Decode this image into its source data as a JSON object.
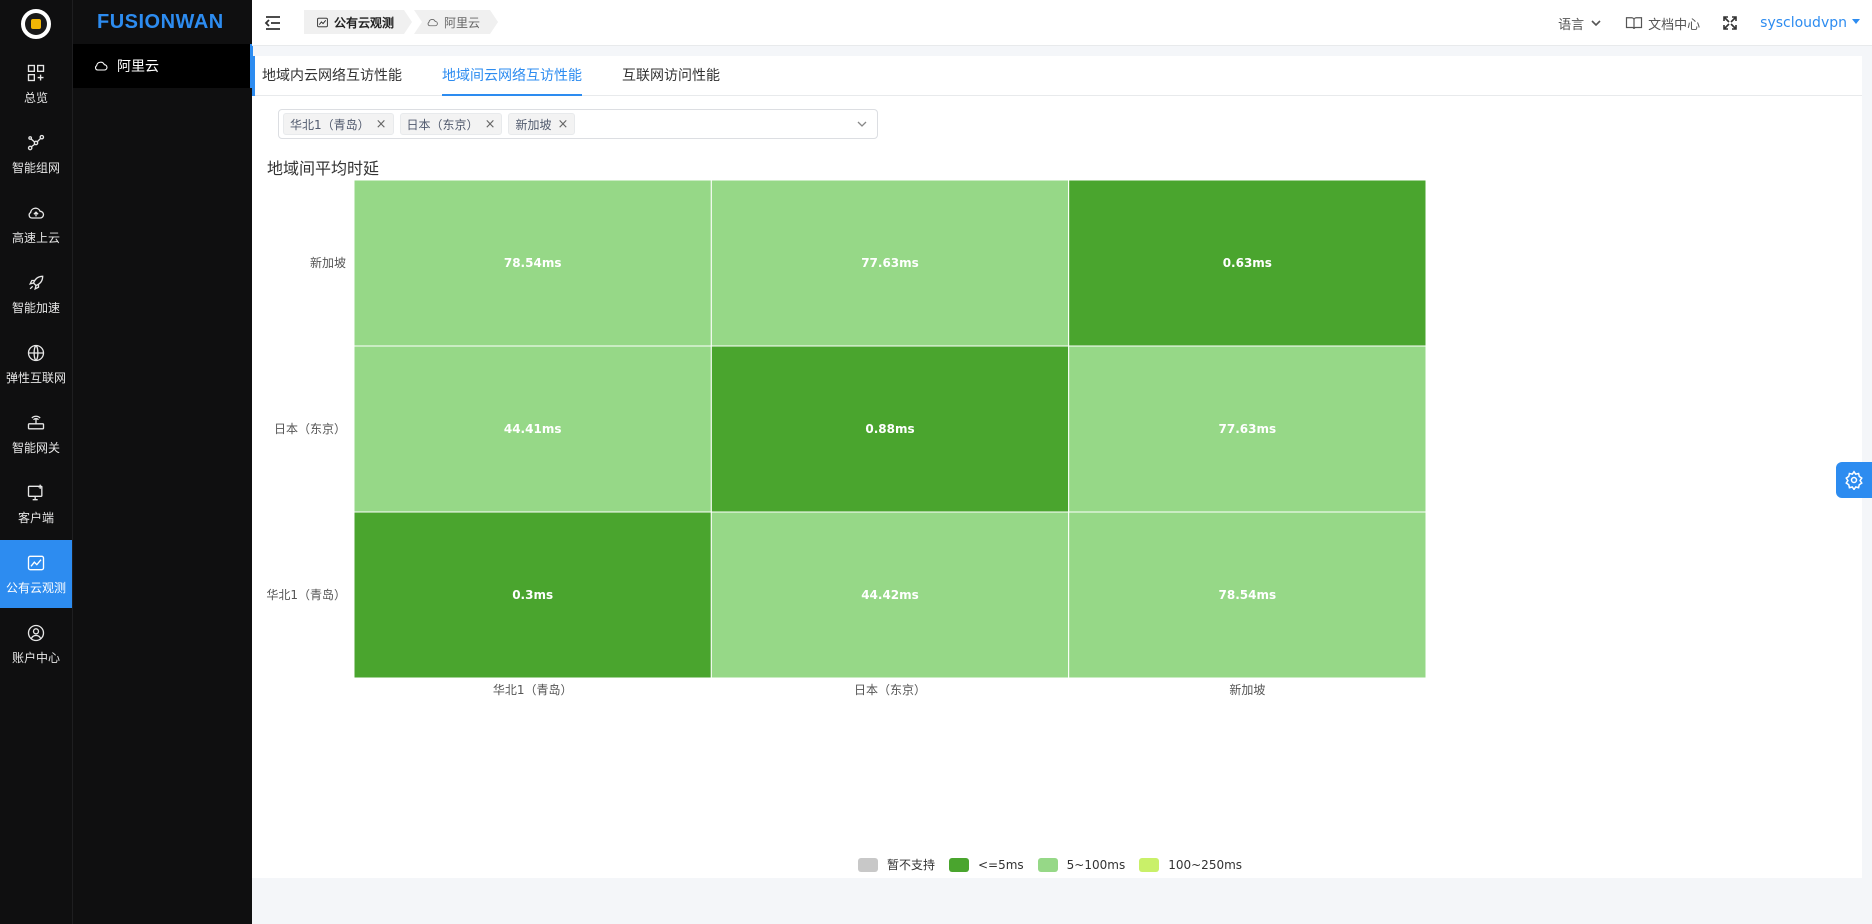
{
  "brand": "FUSIONWAN",
  "rail": {
    "items": [
      {
        "label": "总览",
        "icon": "dashboard-icon"
      },
      {
        "label": "智能组网",
        "icon": "network-icon"
      },
      {
        "label": "高速上云",
        "icon": "cloud-upload-icon"
      },
      {
        "label": "智能加速",
        "icon": "rocket-icon"
      },
      {
        "label": "弹性互联网",
        "icon": "globe-icon"
      },
      {
        "label": "智能网关",
        "icon": "router-icon"
      },
      {
        "label": "客户端",
        "icon": "monitor-icon"
      },
      {
        "label": "公有云观测",
        "icon": "chart-icon"
      },
      {
        "label": "账户中心",
        "icon": "user-icon"
      }
    ],
    "active_index": 7
  },
  "subnav": {
    "item": "阿里云"
  },
  "header": {
    "breadcrumbs": [
      "公有云观测",
      "阿里云"
    ],
    "language": "语言",
    "docs": "文档中心",
    "user": "syscloudvpn"
  },
  "tabs": [
    {
      "label": "地域内云网络互访性能",
      "active": false
    },
    {
      "label": "地域间云网络互访性能",
      "active": true
    },
    {
      "label": "互联网访问性能",
      "active": false
    }
  ],
  "region_select": {
    "selected": [
      "华北1（青岛）",
      "日本（东京）",
      "新加坡"
    ]
  },
  "section_title": "地域间平均时延",
  "chart_data": {
    "type": "heatmap",
    "x_categories": [
      "华北1（青岛）",
      "日本（东京）",
      "新加坡"
    ],
    "y_categories": [
      "华北1（青岛）",
      "日本（东京）",
      "新加坡"
    ],
    "cells": [
      {
        "x": "华北1（青岛）",
        "y": "新加坡",
        "label": "78.54ms",
        "value": 78.54
      },
      {
        "x": "日本（东京）",
        "y": "新加坡",
        "label": "77.63ms",
        "value": 77.63
      },
      {
        "x": "新加坡",
        "y": "新加坡",
        "label": "0.63ms",
        "value": 0.63
      },
      {
        "x": "华北1（青岛）",
        "y": "日本（东京）",
        "label": "44.41ms",
        "value": 44.41
      },
      {
        "x": "日本（东京）",
        "y": "日本（东京）",
        "label": "0.88ms",
        "value": 0.88
      },
      {
        "x": "新加坡",
        "y": "日本（东京）",
        "label": "77.63ms",
        "value": 77.63
      },
      {
        "x": "华北1（青岛）",
        "y": "华北1（青岛）",
        "label": "0.3ms",
        "value": 0.3
      },
      {
        "x": "日本（东京）",
        "y": "华北1（青岛）",
        "label": "44.42ms",
        "value": 44.42
      },
      {
        "x": "新加坡",
        "y": "华北1（青岛）",
        "label": "78.54ms",
        "value": 78.54
      }
    ],
    "legend": [
      {
        "label": "暂不支持",
        "color": "#c8c8c8"
      },
      {
        "label": "<=5ms",
        "color": "#4aa52e",
        "max": 5
      },
      {
        "label": "5~100ms",
        "color": "#96d887",
        "max": 100
      },
      {
        "label": "100~250ms",
        "color": "#c9f069",
        "max": 250
      }
    ]
  },
  "colors": {
    "accent": "#2d8cf0",
    "sidebar_bg": "#0f0f10"
  }
}
